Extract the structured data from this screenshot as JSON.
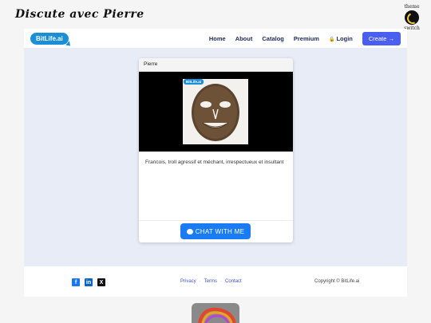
{
  "page": {
    "title": "Discute avec Pierre",
    "theme_switch_top": "theme",
    "theme_switch_bottom": "switch"
  },
  "navbar": {
    "logo": "BitLife.ai",
    "links": [
      "Home",
      "About",
      "Catalog",
      "Premium",
      "Login"
    ],
    "create_label": "Create →"
  },
  "card": {
    "name": "Pierre",
    "image_badge": "BitLife.ai",
    "description": "Francois, troll agressif et méchant, irrespectueux et insultant",
    "chat_button": "CHAT WITH ME"
  },
  "footer": {
    "social": [
      "facebook-icon",
      "linkedin-icon",
      "x-icon"
    ],
    "links": [
      "Privacy",
      "Terms",
      "Contact"
    ],
    "copyright": "Copyright © BitLife.ai"
  },
  "colors": {
    "accent": "#1a7cf5",
    "create": "#4a5ff0",
    "logo": "#1a8fd8",
    "main_bg": "#e8ecf7"
  }
}
